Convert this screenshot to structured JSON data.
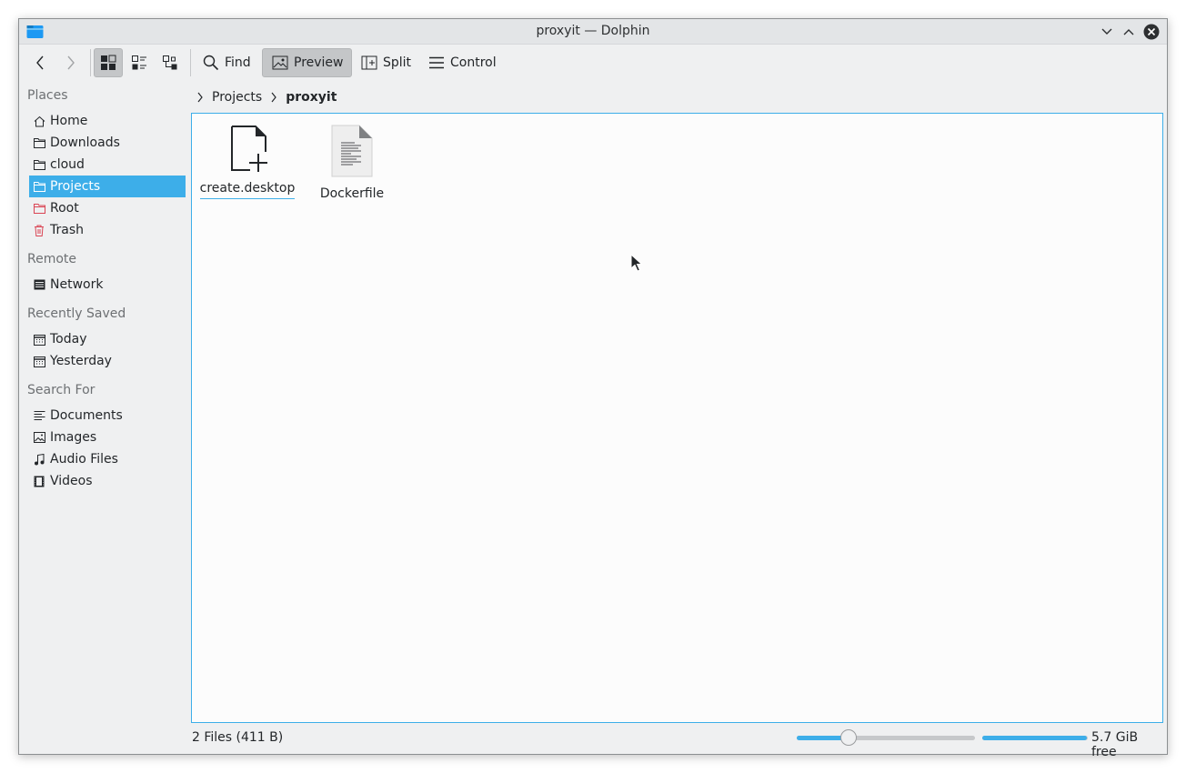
{
  "window": {
    "title": "proxyit — Dolphin"
  },
  "toolbar": {
    "back_label": "back",
    "forward_label": "forward",
    "find_label": "Find",
    "preview_label": "Preview",
    "split_label": "Split",
    "control_label": "Control"
  },
  "sidebar": {
    "sections": [
      {
        "title": "Places",
        "items": [
          {
            "label": "Home",
            "icon": "home-icon"
          },
          {
            "label": "Downloads",
            "icon": "folder-icon"
          },
          {
            "label": "cloud",
            "icon": "folder-icon"
          },
          {
            "label": "Projects",
            "icon": "folder-icon",
            "selected": true
          },
          {
            "label": "Root",
            "icon": "folder-red-icon"
          },
          {
            "label": "Trash",
            "icon": "trash-icon"
          }
        ]
      },
      {
        "title": "Remote",
        "items": [
          {
            "label": "Network",
            "icon": "network-icon"
          }
        ]
      },
      {
        "title": "Recently Saved",
        "items": [
          {
            "label": "Today",
            "icon": "calendar-icon"
          },
          {
            "label": "Yesterday",
            "icon": "calendar-icon"
          }
        ]
      },
      {
        "title": "Search For",
        "items": [
          {
            "label": "Documents",
            "icon": "document-icon"
          },
          {
            "label": "Images",
            "icon": "image-icon"
          },
          {
            "label": "Audio Files",
            "icon": "music-icon"
          },
          {
            "label": "Videos",
            "icon": "video-icon"
          }
        ]
      }
    ]
  },
  "breadcrumb": {
    "items": [
      "Projects",
      "proxyit"
    ]
  },
  "files": [
    {
      "name": "create.desktop",
      "icon": "new-file-icon",
      "focused": true
    },
    {
      "name": "Dockerfile",
      "icon": "text-file-icon",
      "focused": false
    }
  ],
  "status": {
    "summary": "2 Files (411 B)",
    "free_space": "5.7 GiB free",
    "zoom_level_fraction": 0.27,
    "disk_used_fraction": 0.99
  },
  "colors": {
    "accent": "#3daee9",
    "window_bg": "#eff0f1",
    "root_red": "#da4453"
  }
}
